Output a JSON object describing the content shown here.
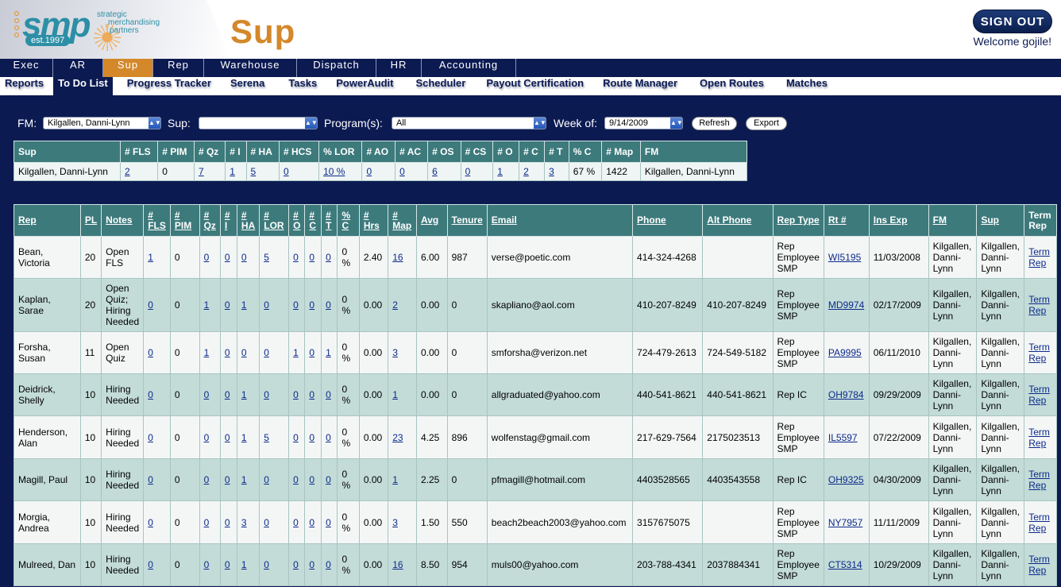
{
  "header": {
    "logo_text": "smp",
    "logo_est": "est.1997",
    "logo_tagline": [
      "strategic",
      "merchandising",
      "partners"
    ],
    "title": "Sup",
    "sign_out": "SIGN OUT",
    "welcome": "Welcome gojile!"
  },
  "main_nav": [
    {
      "label": "Exec",
      "width": 67
    },
    {
      "label": "AR",
      "width": 63
    },
    {
      "label": "Sup",
      "width": 63,
      "active": true
    },
    {
      "label": "Rep",
      "width": 64
    },
    {
      "label": "Warehouse",
      "width": 117
    },
    {
      "label": "Dispatch",
      "width": 100
    },
    {
      "label": "HR",
      "width": 57
    },
    {
      "label": "Accounting",
      "width": 119
    }
  ],
  "sub_nav": [
    "Reports",
    "To Do List",
    "Progress Tracker",
    "Serena",
    "Tasks",
    "PowerAudit",
    "Scheduler",
    "Payout Certification",
    "Route Manager",
    "Open Routes",
    "Matches"
  ],
  "sub_nav_active": "To Do List",
  "filters": {
    "fm_label": "FM:",
    "fm_value": "Kilgallen, Danni-Lynn",
    "sup_label": "Sup:",
    "sup_value": "",
    "programs_label": "Program(s):",
    "programs_value": "All",
    "week_label": "Week of:",
    "week_value": "9/14/2009",
    "refresh": "Refresh",
    "export": "Export"
  },
  "summary": {
    "headers": [
      "Sup",
      "# FLS",
      "# PIM",
      "# Qz",
      "# I",
      "# HA",
      "# HCS",
      "% LOR",
      "# AO",
      "# AC",
      "# OS",
      "# CS",
      "# O",
      "# C",
      "# T",
      "% C",
      "# Map",
      "FM"
    ],
    "row": [
      "Kilgallen, Danni-Lynn",
      "2",
      "0",
      "7",
      "1",
      "5",
      "0",
      "10 %",
      "0",
      "0",
      "6",
      "0",
      "1",
      "2",
      "3",
      "67 %",
      "1422",
      "Kilgallen, Danni-Lynn"
    ],
    "links": [
      1,
      3,
      4,
      5,
      6,
      7,
      8,
      9,
      10,
      11,
      12,
      13,
      14
    ]
  },
  "reps": {
    "headers": [
      "Rep",
      "PL",
      "Notes",
      "# FLS",
      "# PIM",
      "# Qz",
      "# I",
      "# HA",
      "# LOR",
      "# O",
      "# C",
      "# T",
      "% C",
      "# Hrs",
      "# Map",
      "Avg",
      "Tenure",
      "Email",
      "Phone",
      "Alt Phone",
      "Rep Type",
      "Rt #",
      "Ins Exp",
      "FM",
      "Sup",
      "Term Rep"
    ],
    "rows": [
      [
        "Bean, Victoria",
        "20",
        "Open FLS",
        "1",
        "0",
        "0",
        "0",
        "0",
        "5",
        "0",
        "0",
        "0",
        "0 %",
        "2.40",
        "16",
        "6.00",
        "987",
        "verse@poetic.com",
        "414-324-4268",
        "",
        "Rep Employee SMP",
        "WI5195",
        "11/03/2008",
        "Kilgallen, Danni-Lynn",
        "Kilgallen, Danni-Lynn",
        "Term Rep"
      ],
      [
        "Kaplan, Sarae",
        "20",
        "Open Quiz; Hiring Needed",
        "0",
        "0",
        "1",
        "0",
        "1",
        "0",
        "0",
        "0",
        "0",
        "0 %",
        "0.00",
        "2",
        "0.00",
        "0",
        "skapliano@aol.com",
        "410-207-8249",
        "410-207-8249",
        "Rep Employee SMP",
        "MD9974",
        "02/17/2009",
        "Kilgallen, Danni-Lynn",
        "Kilgallen, Danni-Lynn",
        "Term Rep"
      ],
      [
        "Forsha, Susan",
        "11",
        "Open Quiz",
        "0",
        "0",
        "1",
        "0",
        "0",
        "0",
        "1",
        "0",
        "1",
        "0 %",
        "0.00",
        "3",
        "0.00",
        "0",
        "smforsha@verizon.net",
        "724-479-2613",
        "724-549-5182",
        "Rep Employee SMP",
        "PA9995",
        "06/11/2010",
        "Kilgallen, Danni-Lynn",
        "Kilgallen, Danni-Lynn",
        "Term Rep"
      ],
      [
        "Deidrick, Shelly",
        "10",
        "Hiring Needed",
        "0",
        "0",
        "0",
        "0",
        "1",
        "0",
        "0",
        "0",
        "0",
        "0 %",
        "0.00",
        "1",
        "0.00",
        "0",
        "allgraduated@yahoo.com",
        "440-541-8621",
        "440-541-8621",
        "Rep IC",
        "OH9784",
        "09/29/2009",
        "Kilgallen, Danni-Lynn",
        "Kilgallen, Danni-Lynn",
        "Term Rep"
      ],
      [
        "Henderson, Alan",
        "10",
        "Hiring Needed",
        "0",
        "0",
        "0",
        "0",
        "1",
        "5",
        "0",
        "0",
        "0",
        "0 %",
        "0.00",
        "23",
        "4.25",
        "896",
        "wolfenstag@gmail.com",
        "217-629-7564",
        "2175023513",
        "Rep Employee SMP",
        "IL5597",
        "07/22/2009",
        "Kilgallen, Danni-Lynn",
        "Kilgallen, Danni-Lynn",
        "Term Rep"
      ],
      [
        "Magill, Paul",
        "10",
        "Hiring Needed",
        "0",
        "0",
        "0",
        "0",
        "1",
        "0",
        "0",
        "0",
        "0",
        "0 %",
        "0.00",
        "1",
        "2.25",
        "0",
        "pfmagill@hotmail.com",
        "4403528565",
        "4403543558",
        "Rep IC",
        "OH9325",
        "04/30/2009",
        "Kilgallen, Danni-Lynn",
        "Kilgallen, Danni-Lynn",
        "Term Rep"
      ],
      [
        "Morgia, Andrea",
        "10",
        "Hiring Needed",
        "0",
        "0",
        "0",
        "0",
        "3",
        "0",
        "0",
        "0",
        "0",
        "0 %",
        "0.00",
        "3",
        "1.50",
        "550",
        "beach2beach2003@yahoo.com",
        "3157675075",
        "",
        "Rep Employee SMP",
        "NY7957",
        "11/11/2009",
        "Kilgallen, Danni-Lynn",
        "Kilgallen, Danni-Lynn",
        "Term Rep"
      ],
      [
        "Mulreed, Dan",
        "10",
        "Hiring Needed",
        "0",
        "0",
        "0",
        "0",
        "1",
        "0",
        "0",
        "0",
        "0",
        "0 %",
        "0.00",
        "16",
        "8.50",
        "954",
        "muls00@yahoo.com",
        "203-788-4341",
        "2037884341",
        "Rep Employee SMP",
        "CT5314",
        "10/29/2009",
        "Kilgallen, Danni-Lynn",
        "Kilgallen, Danni-Lynn",
        "Term Rep"
      ]
    ]
  },
  "colors": {
    "navy": "#0c1a52",
    "orange": "#d4882a",
    "teal_header": "#3d7a7c",
    "row_light": "#f4f6f6",
    "row_teal": "#c3dcd8"
  }
}
